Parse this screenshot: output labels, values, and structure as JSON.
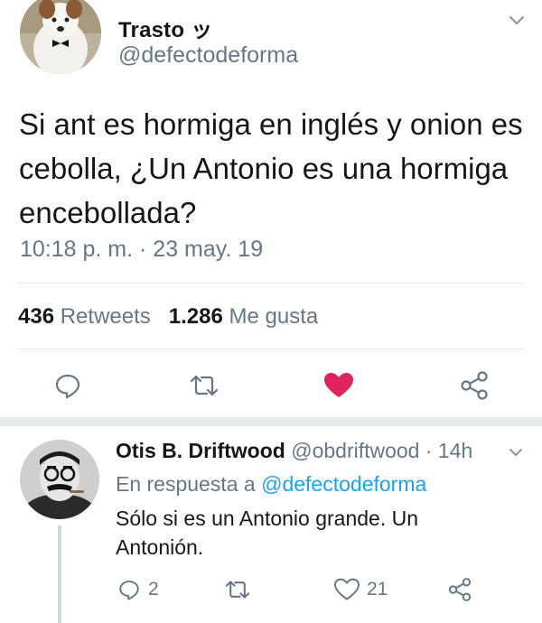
{
  "tweet": {
    "author_name": "Trasto ッ",
    "author_handle": "@defectodeforma",
    "text": "Si ant es hormiga en inglés y onion es cebolla, ¿Un Antonio es una hormiga encebollada?",
    "timestamp": "10:18 p. m. · 23 may. 19",
    "retweets_count": "436",
    "retweets_label": "Retweets",
    "likes_count": "1.286",
    "likes_label": "Me gusta",
    "liked": true,
    "like_color": "#e0245e"
  },
  "reply": {
    "author_name": "Otis B. Driftwood",
    "author_handle": "@obdriftwood",
    "time": "· 14h",
    "replying_to_label": "En respuesta a",
    "replying_to_handle": "@defectodeforma",
    "text": "Sólo si es un Antonio grande. Un Antonión.",
    "reply_count": "2",
    "like_count": "21"
  },
  "icons": [
    "chevron-down-icon",
    "reply-icon",
    "retweet-icon",
    "heart-icon",
    "share-icon"
  ],
  "colors": {
    "secondary_text": "#657786",
    "link": "#1da1f2",
    "divider": "#e1e8ed"
  }
}
